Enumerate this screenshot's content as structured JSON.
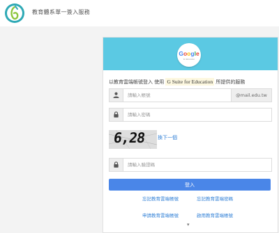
{
  "header": {
    "title": "教育體系單一簽入服務",
    "logo_icon": "education-sso-logo"
  },
  "card": {
    "header_color": "#5bc9e3",
    "brand": {
      "word": "Google",
      "sub": "for Education",
      "colors": [
        "#4285f4",
        "#ea4335",
        "#fbbc05",
        "#4285f4",
        "#34a853",
        "#ea4335"
      ]
    },
    "intro": {
      "prefix": "以教育雲端帳號登入 使用",
      "service": "G Suite for Education",
      "suffix": "所提供的服務"
    },
    "account": {
      "placeholder": "請輸入帳號",
      "value": "",
      "domain": "@mail.edu.tw",
      "icon": "user-icon"
    },
    "password": {
      "placeholder": "請輸入密碼",
      "value": "",
      "icon": "lock-icon"
    },
    "captcha": {
      "text": "6,28",
      "refresh_label": "換下一個"
    },
    "captcha_input": {
      "placeholder": "請輸入驗證碼",
      "value": "",
      "icon": "lock-icon"
    },
    "login_label": "登入",
    "links_row1": [
      "忘記教育雲端帳號",
      "忘記教育雲端密碼"
    ],
    "links_row2": [
      "申請教育雲端帳號",
      "啟用教育雲端帳號"
    ],
    "accent": "#4a86e8"
  }
}
